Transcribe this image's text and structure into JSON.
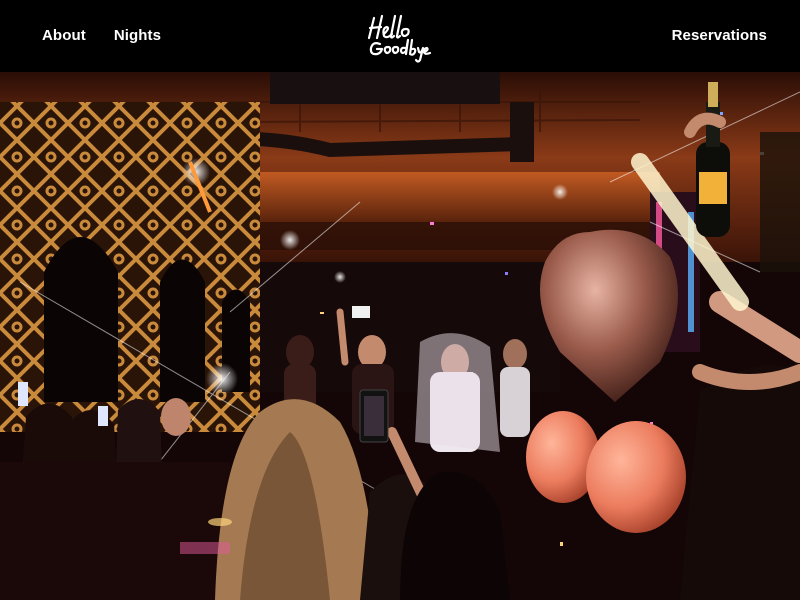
{
  "brand": {
    "logo_text": "Hello Goodbye"
  },
  "nav": {
    "about_label": "About",
    "nights_label": "Nights",
    "reservations_label": "Reservations"
  },
  "hero": {
    "image_alt": "party-crowd-photo",
    "colors": {
      "ceiling": "#7a3416",
      "lattice": "#c98a3c",
      "balloon": "#f08a6a",
      "balloon_foil": "#b06a5a"
    }
  }
}
